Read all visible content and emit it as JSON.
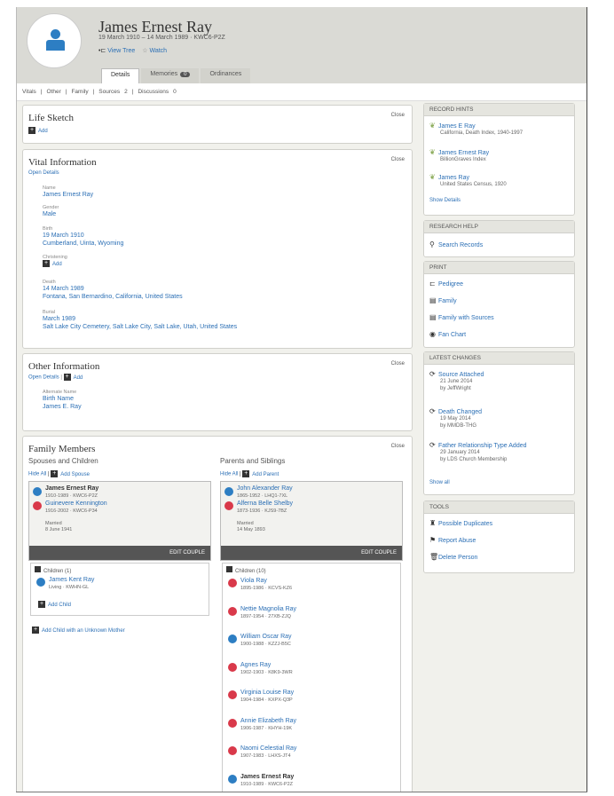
{
  "person": {
    "name": "James Ernest Ray",
    "dates": "19 March 1910 – 14 March 1989 · KWC6-P2Z",
    "view_tree": "View Tree",
    "watch": "Watch"
  },
  "tabs": [
    {
      "label": "Details"
    },
    {
      "label": "Memories",
      "badge": "0"
    },
    {
      "label": "Ordinances"
    }
  ],
  "subnav": {
    "vitals": "Vitals",
    "other": "Other",
    "family": "Family",
    "sources": "Sources",
    "sources_count": "2",
    "discussions": "Discussions",
    "discussions_count": "0"
  },
  "life_sketch": {
    "title": "Life Sketch",
    "close": "Close",
    "add": "Add"
  },
  "vital": {
    "title": "Vital Information",
    "close": "Close",
    "open_details": "Open Details",
    "name_label": "Name",
    "name": "James Ernest Ray",
    "gender_label": "Gender",
    "gender": "Male",
    "birth_label": "Birth",
    "birth_date": "19 March 1910",
    "birth_place": "Cumberland, Uinta, Wyoming",
    "christening_label": "Christening",
    "christening_add": "Add",
    "death_label": "Death",
    "death_date": "14 March 1989",
    "death_place": "Fontana, San Bernardino, California, United States",
    "burial_label": "Burial",
    "burial_date": "March 1989",
    "burial_place": "Salt Lake City Cemetery, Salt Lake City, Salt Lake, Utah, United States"
  },
  "other": {
    "title": "Other Information",
    "close": "Close",
    "open_details": "Open Details",
    "add": "Add",
    "alt_label": "Alternate Name",
    "alt_type": "Birth Name",
    "alt_name": "James E. Ray"
  },
  "family": {
    "title": "Family Members",
    "close": "Close",
    "spouses_title": "Spouses and Children",
    "parents_title": "Parents and Siblings",
    "hide_all": "Hide All",
    "add_spouse": "Add Spouse",
    "add_parent": "Add Parent",
    "spouse_husband": "James Ernest Ray",
    "spouse_husband_meta": "1910-1989 · KWC6-P2Z",
    "spouse_wife": "Guinevere Kennington",
    "spouse_wife_meta": "1916-2002 · KWC6-P34",
    "spouse_married_label": "Married",
    "spouse_married": "8 June 1941",
    "parent_father": "John Alexander Ray",
    "parent_father_meta": "1865-1952 · LHQ1-7XL",
    "parent_mother": "Alferna Belle Shelby",
    "parent_mother_meta": "1873-1936 · KJS9-7BZ",
    "parent_married_label": "Married",
    "parent_married": "14 May 1893",
    "edit_couple": "EDIT COUPLE",
    "children_label": "Children (1)",
    "siblings_label": "Children (10)",
    "child_name": "James Kent Ray",
    "child_meta": "Living · KWHN-GL",
    "add_child": "Add Child",
    "add_child_unknown": "Add Child with an Unknown Mother",
    "siblings": [
      {
        "name": "Viola Ray",
        "meta": "1895-1986 · KCVS-KZ6",
        "sex": "female"
      },
      {
        "name": "Nettie Magnolia Ray",
        "meta": "1897-1954 · 27XB-ZJQ",
        "sex": "female"
      },
      {
        "name": "William Oscar Ray",
        "meta": "1900-1988 · KZZJ-B5C",
        "sex": "male"
      },
      {
        "name": "Agnes Ray",
        "meta": "1902-1903 · K8K9-3WR",
        "sex": "female"
      },
      {
        "name": "Virginia Louise Ray",
        "meta": "1904-1984 · KXPX-Q3P",
        "sex": "female"
      },
      {
        "name": "Annie Elizabeth Ray",
        "meta": "1906-1987 · KHYH-19K",
        "sex": "female"
      },
      {
        "name": "Naomi Celestial Ray",
        "meta": "1907-1983 · LHXS-JT4",
        "sex": "female"
      },
      {
        "name": "James Ernest Ray",
        "meta": "1910-1989 · KWC6-P2Z",
        "sex": "male"
      }
    ]
  },
  "record_hints": {
    "title": "RECORD HINTS",
    "items": [
      {
        "name": "James E Ray",
        "source": "California, Death Index, 1940-1997"
      },
      {
        "name": "James Ernest Ray",
        "source": "BillionGraves Index"
      },
      {
        "name": "James Ray",
        "source": "United States Census, 1920"
      }
    ],
    "show_details": "Show Details"
  },
  "research": {
    "title": "RESEARCH HELP",
    "search": "Search Records"
  },
  "print": {
    "title": "PRINT",
    "items": [
      "Pedigree",
      "Family",
      "Family with Sources",
      "Fan Chart"
    ]
  },
  "changes": {
    "title": "LATEST CHANGES",
    "items": [
      {
        "label": "Source Attached",
        "date": "21 June 2014",
        "by": "by JeffWright"
      },
      {
        "label": "Death Changed",
        "date": "19 May 2014",
        "by": "by MMDB-THG"
      },
      {
        "label": "Father Relationship Type Added",
        "date": "29 January 2014",
        "by": "by LDS Church Membership"
      }
    ],
    "show_all": "Show all"
  },
  "tools": {
    "title": "TOOLS",
    "items": [
      "Possible Duplicates",
      "Report Abuse",
      "Delete Person"
    ]
  }
}
